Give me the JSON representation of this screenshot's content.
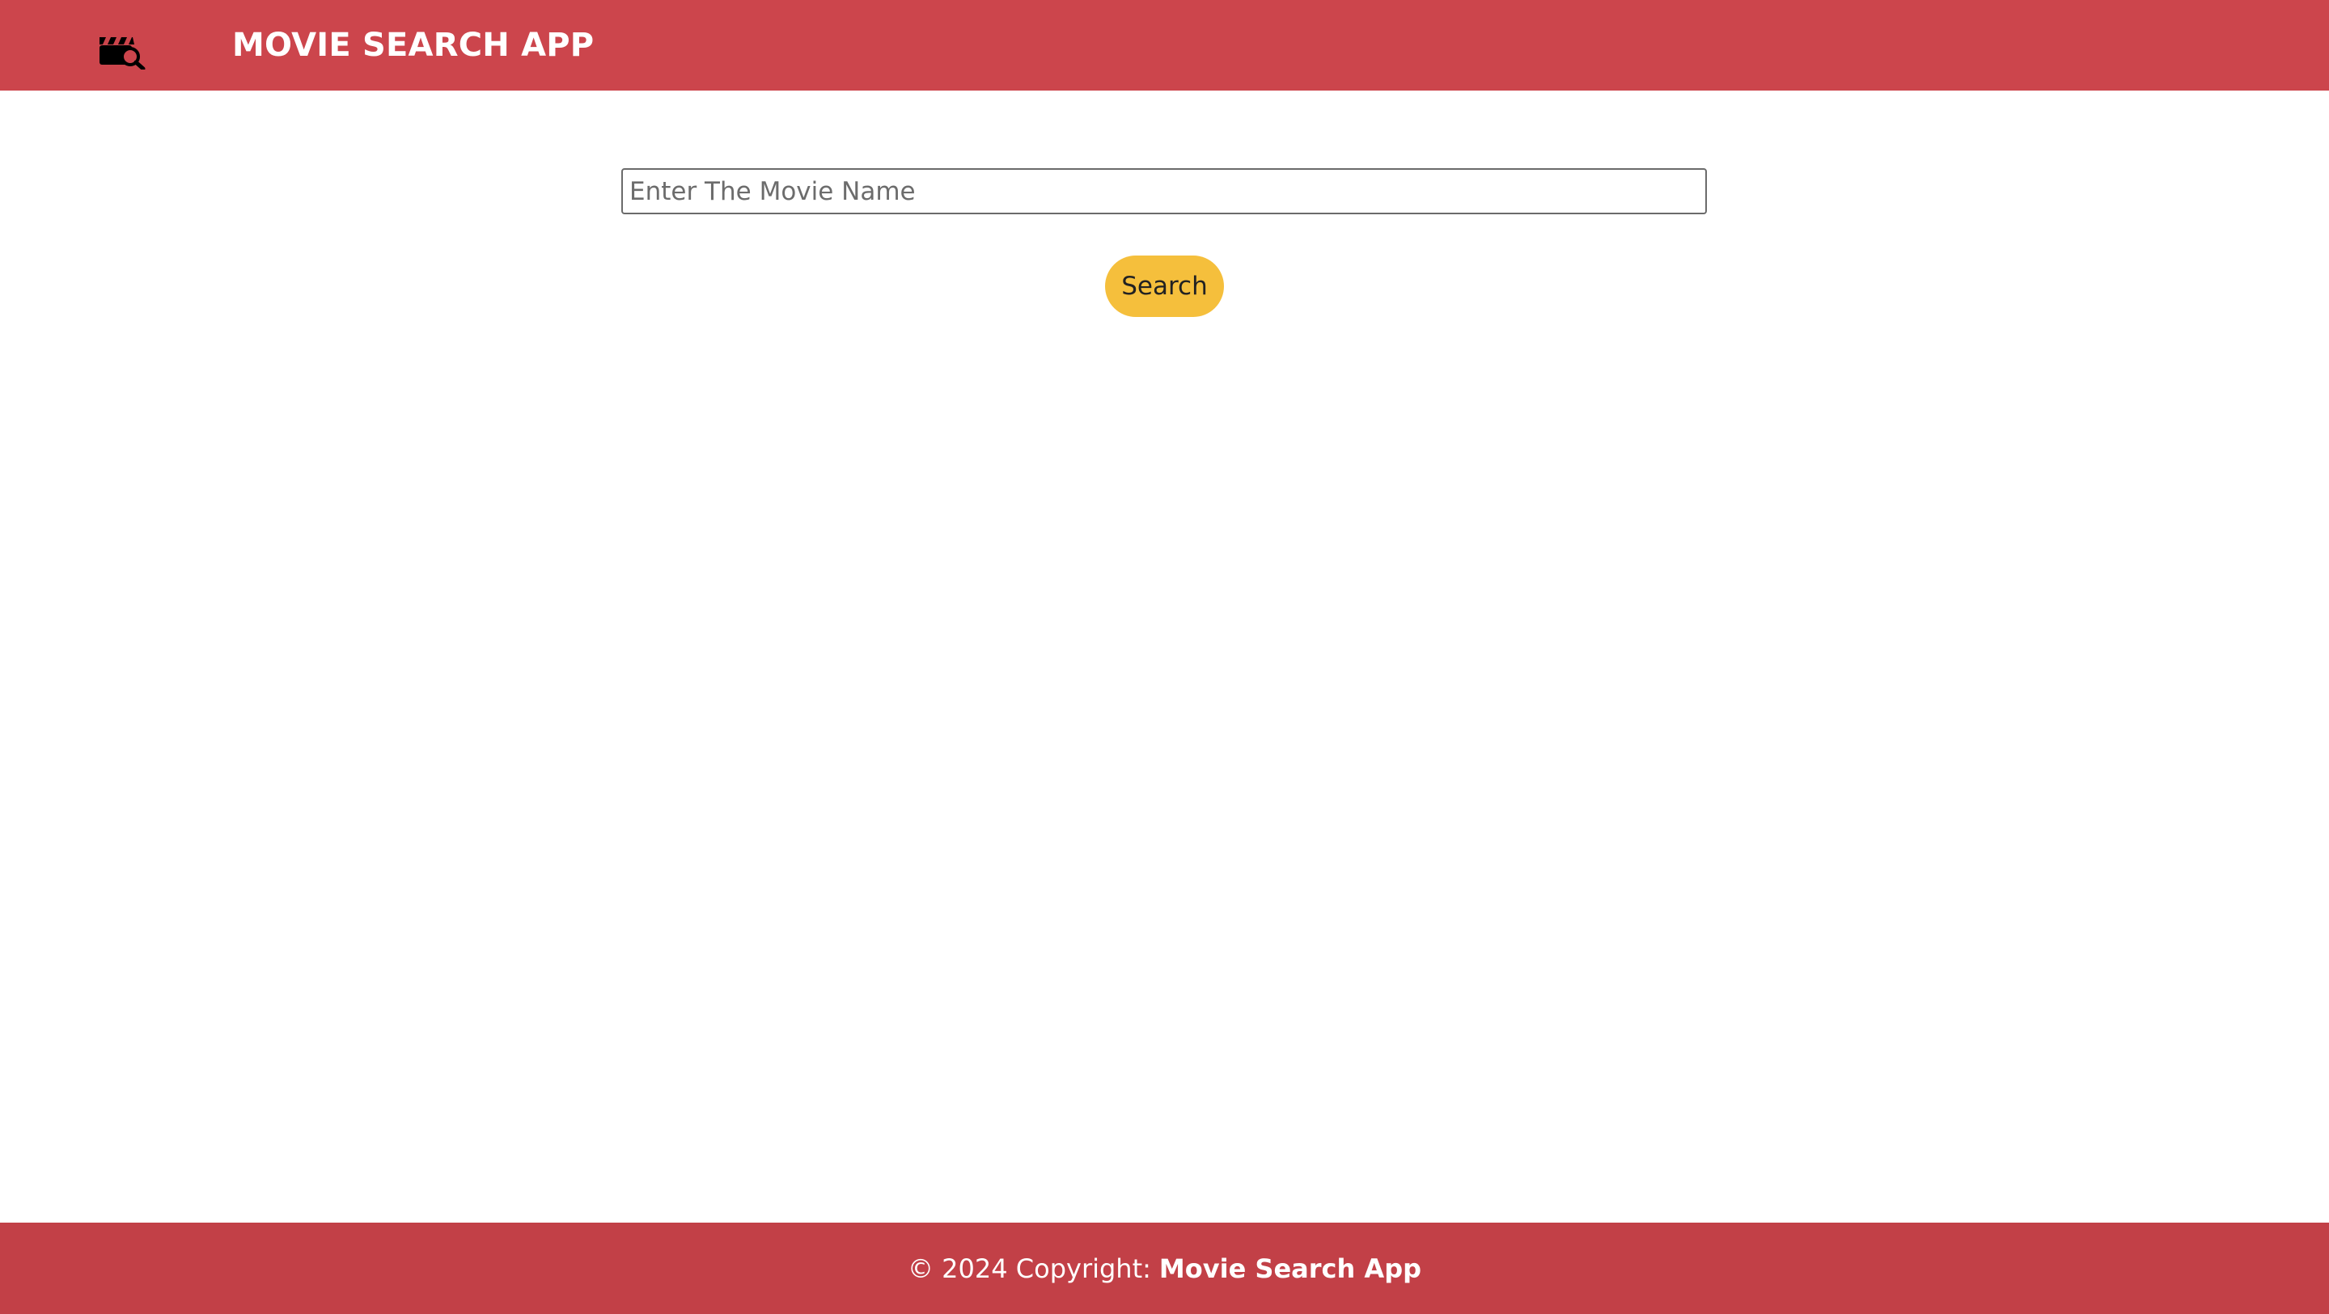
{
  "header": {
    "brand_icon": "movie-search-icon",
    "title": "MOVIE SEARCH APP",
    "background_color": "#cc454c"
  },
  "search": {
    "placeholder": "Enter The Movie Name",
    "value": "",
    "button_label": "Search",
    "button_color": "#f5bf3c"
  },
  "footer": {
    "prefix": "© 2024 Copyright:",
    "app_name": "Movie Search App",
    "background_color": "#c24047"
  }
}
